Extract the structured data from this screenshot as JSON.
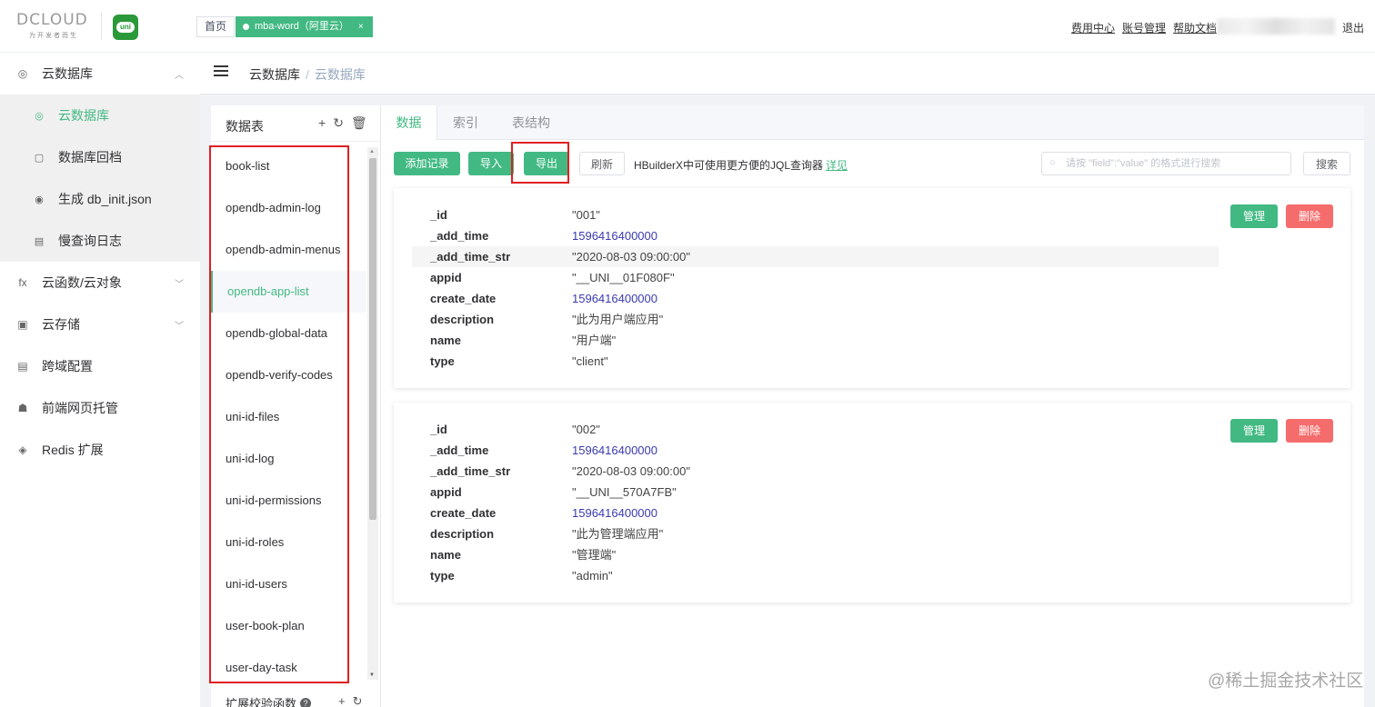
{
  "header": {
    "logo_brand": "DCLOUD",
    "logo_slogan": "为开发者而生",
    "uni_logo": "uni",
    "tab_home": "首页",
    "tab_active": "mba-word（阿里云）",
    "tab_close": "×",
    "links": [
      "费用中心",
      "账号管理",
      "帮助文档"
    ],
    "logout": "退出"
  },
  "sidebar": {
    "items": [
      {
        "label": "云数据库",
        "icon": "database-icon",
        "glyph": "◎",
        "chev": "︿"
      },
      {
        "label": "云函数/云对象",
        "icon": "function-icon",
        "glyph": "fx",
        "chev": "﹀"
      },
      {
        "label": "云存储",
        "icon": "storage-icon",
        "glyph": "▣",
        "chev": "﹀"
      },
      {
        "label": "跨域配置",
        "icon": "cors-icon",
        "glyph": "▤"
      },
      {
        "label": "前端网页托管",
        "icon": "hosting-icon",
        "glyph": "☗"
      },
      {
        "label": "Redis 扩展",
        "icon": "redis-icon",
        "glyph": "◈"
      }
    ],
    "sub_items": [
      {
        "label": "云数据库",
        "icon": "database-icon",
        "glyph": "◎"
      },
      {
        "label": "数据库回档",
        "icon": "rollback-icon",
        "glyph": "▢"
      },
      {
        "label": "生成 db_init.json",
        "icon": "generate-icon",
        "glyph": "◉"
      },
      {
        "label": "慢查询日志",
        "icon": "log-icon",
        "glyph": "▤"
      }
    ]
  },
  "breadcrumb": {
    "parent": "云数据库",
    "sep": "/",
    "current": "云数据库"
  },
  "tables_panel": {
    "title": "数据表",
    "icons": {
      "add": "+",
      "refresh": "↻",
      "delete": "🗑"
    },
    "tables": [
      "book-list",
      "opendb-admin-log",
      "opendb-admin-menus",
      "opendb-app-list",
      "opendb-global-data",
      "opendb-verify-codes",
      "uni-id-files",
      "uni-id-log",
      "uni-id-permissions",
      "uni-id-roles",
      "uni-id-users",
      "user-book-plan",
      "user-day-task"
    ],
    "active_table": "opendb-app-list",
    "ext_label": "扩展校验函数",
    "ext_help": "?"
  },
  "tabs": [
    "数据",
    "索引",
    "表结构"
  ],
  "toolbar": {
    "add": "添加记录",
    "import": "导入",
    "export": "导出",
    "refresh": "刷新",
    "hint": "HBuilderX中可使用更方便的JQL查询器",
    "hint_link": "详见",
    "search_placeholder": "请按 \"field\":\"value\" 的格式进行搜索",
    "search_button": "搜索"
  },
  "records": [
    {
      "fields": [
        {
          "key": "_id",
          "value": "\"001\""
        },
        {
          "key": "_add_time",
          "value": "1596416400000"
        },
        {
          "key": "_add_time_str",
          "value": "\"2020-08-03 09:00:00\""
        },
        {
          "key": "appid",
          "value": "\"__UNI__01F080F\""
        },
        {
          "key": "create_date",
          "value": "1596416400000"
        },
        {
          "key": "description",
          "value": "\"此为用户端应用\""
        },
        {
          "key": "name",
          "value": "\"用户端\""
        },
        {
          "key": "type",
          "value": "\"client\""
        }
      ],
      "manage": "管理",
      "delete": "删除"
    },
    {
      "fields": [
        {
          "key": "_id",
          "value": "\"002\""
        },
        {
          "key": "_add_time",
          "value": "1596416400000"
        },
        {
          "key": "_add_time_str",
          "value": "\"2020-08-03 09:00:00\""
        },
        {
          "key": "appid",
          "value": "\"__UNI__570A7FB\""
        },
        {
          "key": "create_date",
          "value": "1596416400000"
        },
        {
          "key": "description",
          "value": "\"此为管理端应用\""
        },
        {
          "key": "name",
          "value": "\"管理端\""
        },
        {
          "key": "type",
          "value": "\"admin\""
        }
      ],
      "manage": "管理",
      "delete": "删除"
    }
  ],
  "watermark": "@稀土掘金技术社区",
  "colors": {
    "accent": "#42b983",
    "danger": "#f56c6c",
    "highlight_box": "#e02020"
  }
}
